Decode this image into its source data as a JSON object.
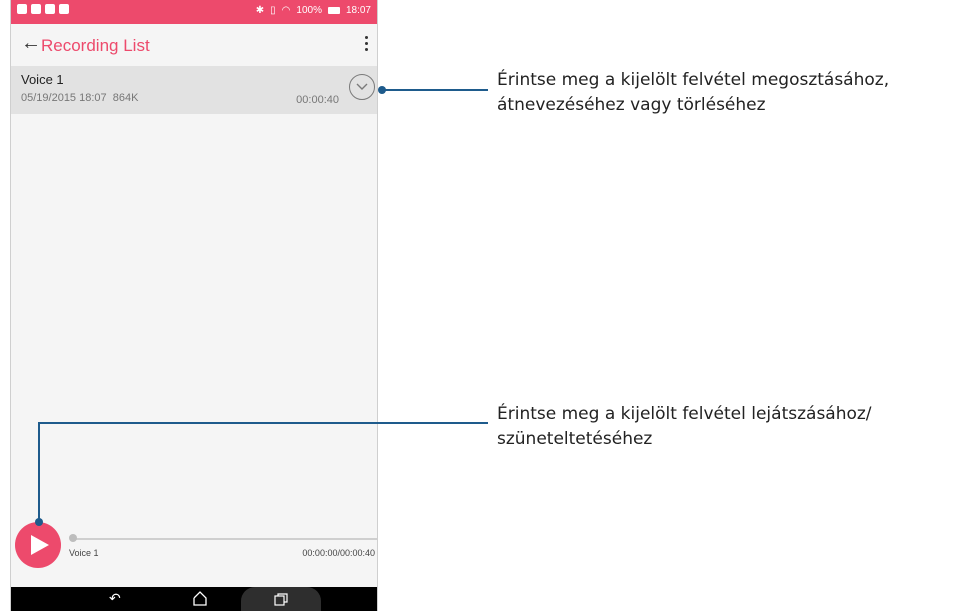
{
  "status_bar": {
    "battery": "100%",
    "time": "18:07"
  },
  "app_bar": {
    "title": "Recording List",
    "back_icon": "arrow-left-icon",
    "menu_icon": "more-vertical-icon"
  },
  "recordings": [
    {
      "name": "Voice 1",
      "date": "05/19/2015 18:07",
      "size": "864K",
      "duration": "00:00:40"
    }
  ],
  "player": {
    "title": "Voice 1",
    "time": "00:00:00/00:00:40",
    "progress": 0
  },
  "callouts": {
    "top": {
      "line1": "Érintse meg a kijelölt felvétel megosztásához,",
      "line2": "átnevezéséhez vagy törléséhez"
    },
    "bottom": {
      "line1": "Érintse meg a kijelölt felvétel lejátszásához/",
      "line2": "szüneteltetéséhez"
    }
  },
  "colors": {
    "accent": "#ed4a6c",
    "callout": "#1e5b8c"
  }
}
